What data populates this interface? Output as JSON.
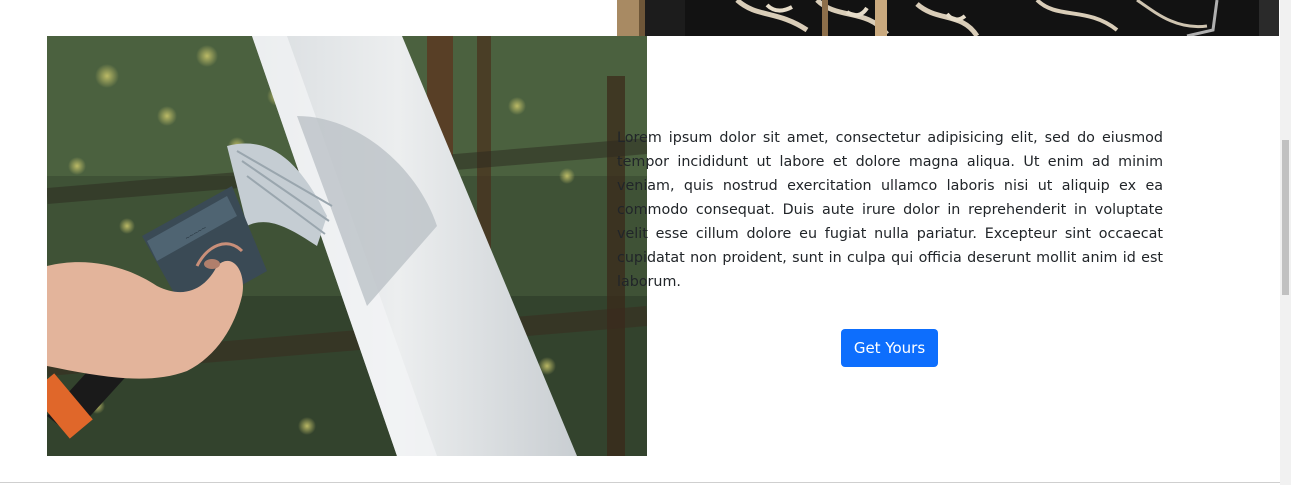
{
  "section": {
    "description": "Lorem ipsum dolor sit amet, consectetur adipisicing elit, sed do eiusmod tempor incididunt ut labore et dolore magna aliqua. Ut enim ad minim veniam, quis nostrud exercitation ullamco laboris nisi ut aliquip ex ea commodo consequat. Duis aute irure dolor in reprehenderit in voluptate velit esse cillum dolore eu fugiat nulla pariatur. Excepteur sint occaecat cupidatat non proident, sunt in culpa qui officia deserunt mollit anim id est laborum.",
    "button_label": "Get Yours"
  },
  "colors": {
    "button_bg": "#0d6efd",
    "button_text": "#ffffff",
    "body_text": "#212529"
  }
}
